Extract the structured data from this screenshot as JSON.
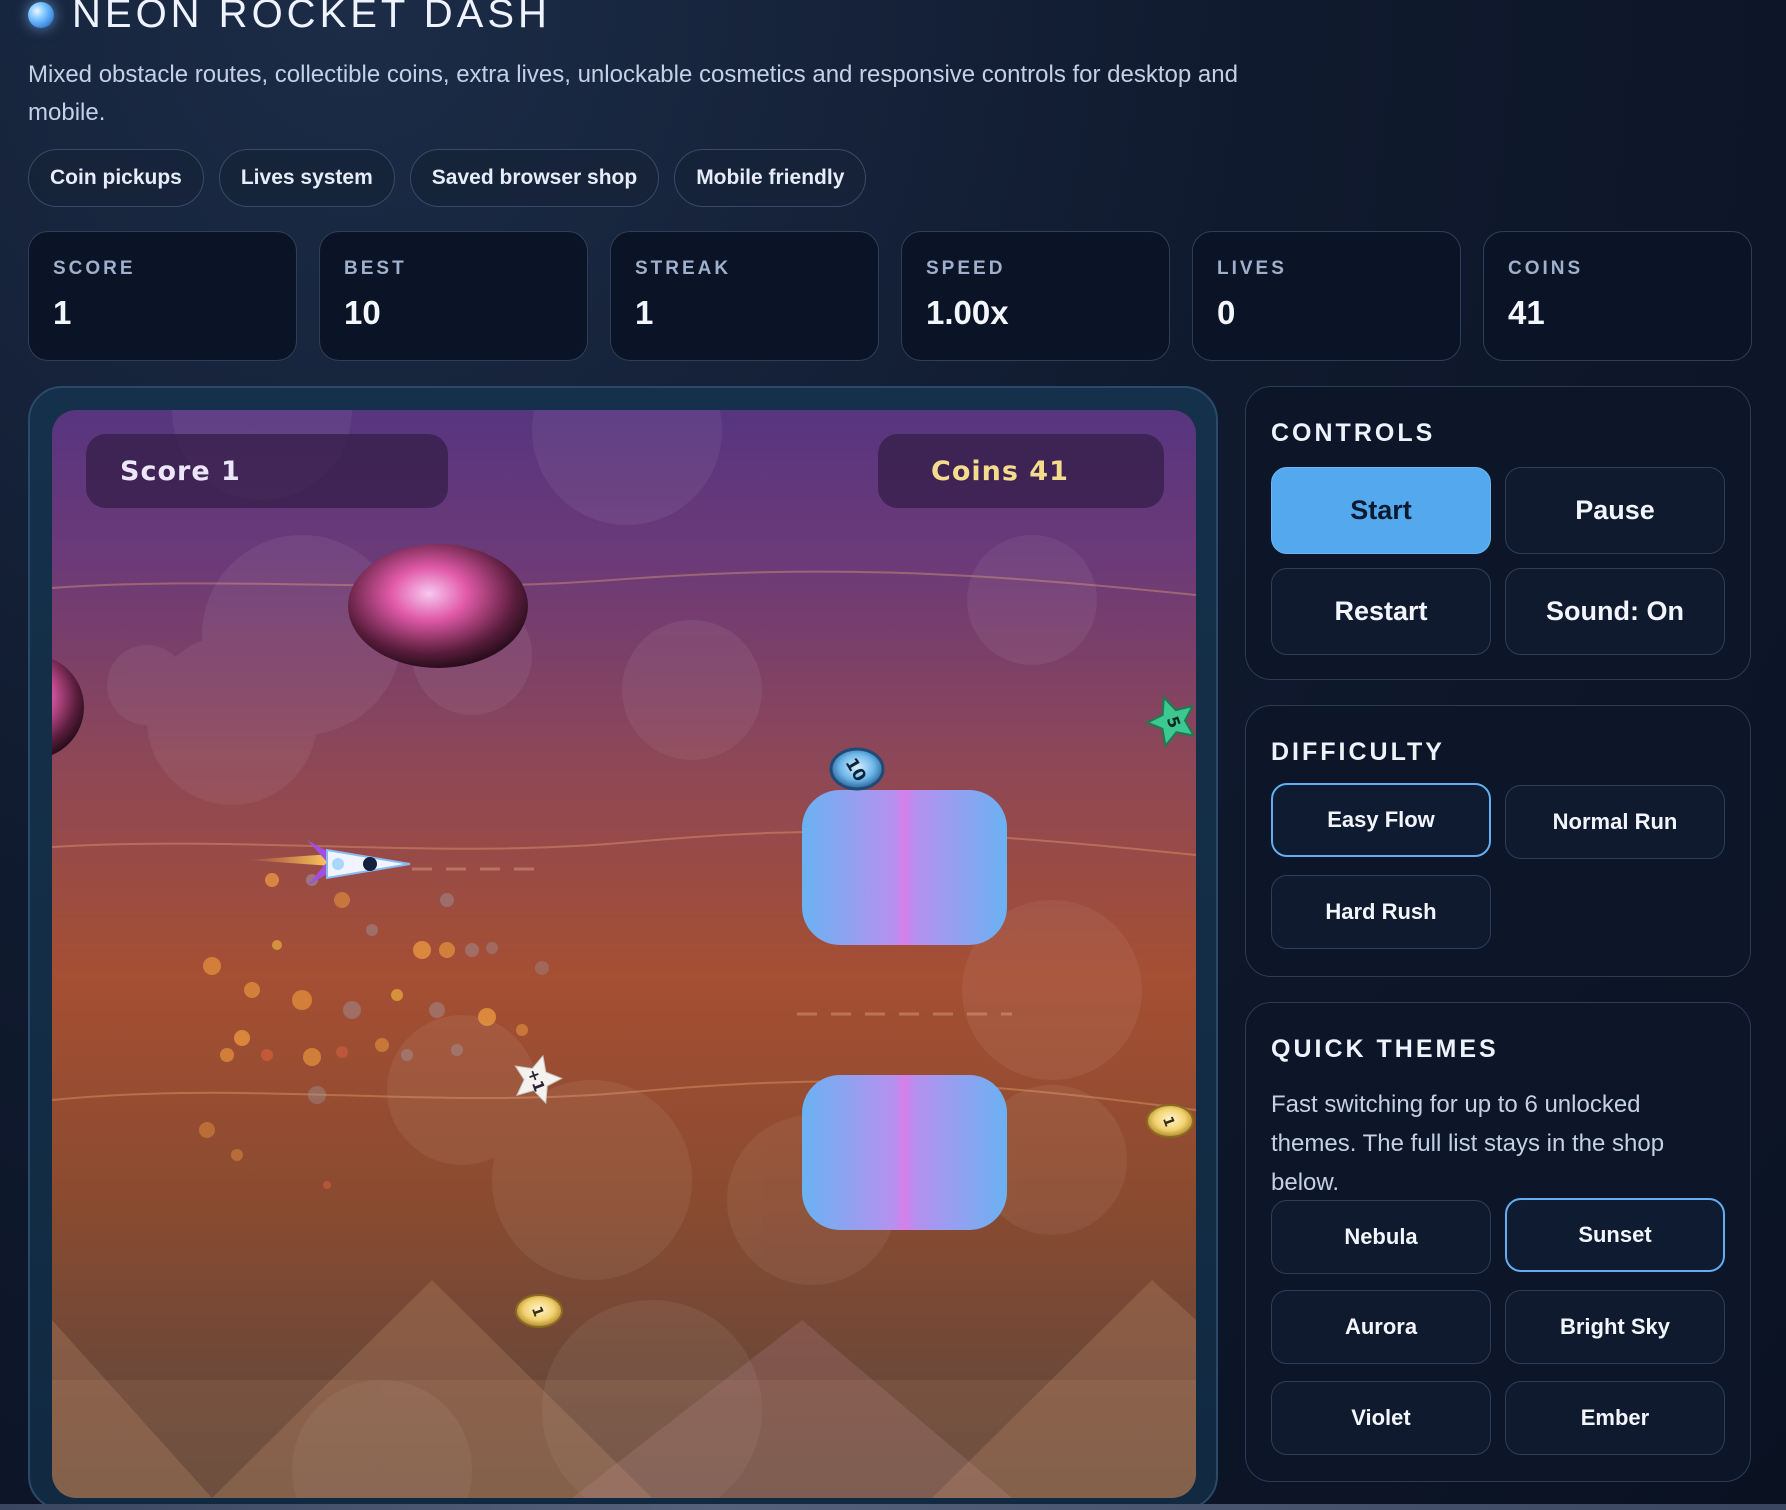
{
  "header": {
    "title": "NEON ROCKET DASH",
    "subtitle": "Mixed obstacle routes, collectible coins, extra lives, unlockable cosmetics and responsive controls for desktop and mobile.",
    "chips": [
      "Coin pickups",
      "Lives system",
      "Saved browser shop",
      "Mobile friendly"
    ]
  },
  "stats": [
    {
      "label": "SCORE",
      "value": "1"
    },
    {
      "label": "BEST",
      "value": "10"
    },
    {
      "label": "STREAK",
      "value": "1"
    },
    {
      "label": "SPEED",
      "value": "1.00x"
    },
    {
      "label": "LIVES",
      "value": "0"
    },
    {
      "label": "COINS",
      "value": "41"
    }
  ],
  "game": {
    "hud_score": "Score 1",
    "hud_coins": "Coins 41",
    "pickups": [
      "10",
      "5",
      "+1",
      "1",
      "1"
    ],
    "theme": "Sunset",
    "colors": {
      "sky_top": "#57357f",
      "sky_bottom": "#a54f33",
      "obstacle_a": "#6ab2f2",
      "obstacle_b": "#d77ee8"
    }
  },
  "controls": {
    "title": "CONTROLS",
    "start": "Start",
    "pause": "Pause",
    "restart": "Restart",
    "sound": "Sound: On"
  },
  "difficulty": {
    "title": "DIFFICULTY",
    "options": [
      "Easy Flow",
      "Normal Run",
      "Hard Rush"
    ],
    "selected": "Easy Flow"
  },
  "themes": {
    "title": "QUICK THEMES",
    "description": "Fast switching for up to 6 unlocked themes. The full list stays in the shop below.",
    "options": [
      "Nebula",
      "Sunset",
      "Aurora",
      "Bright Sky",
      "Violet",
      "Ember"
    ],
    "selected": "Sunset"
  },
  "accent_color": "#54a9ee"
}
